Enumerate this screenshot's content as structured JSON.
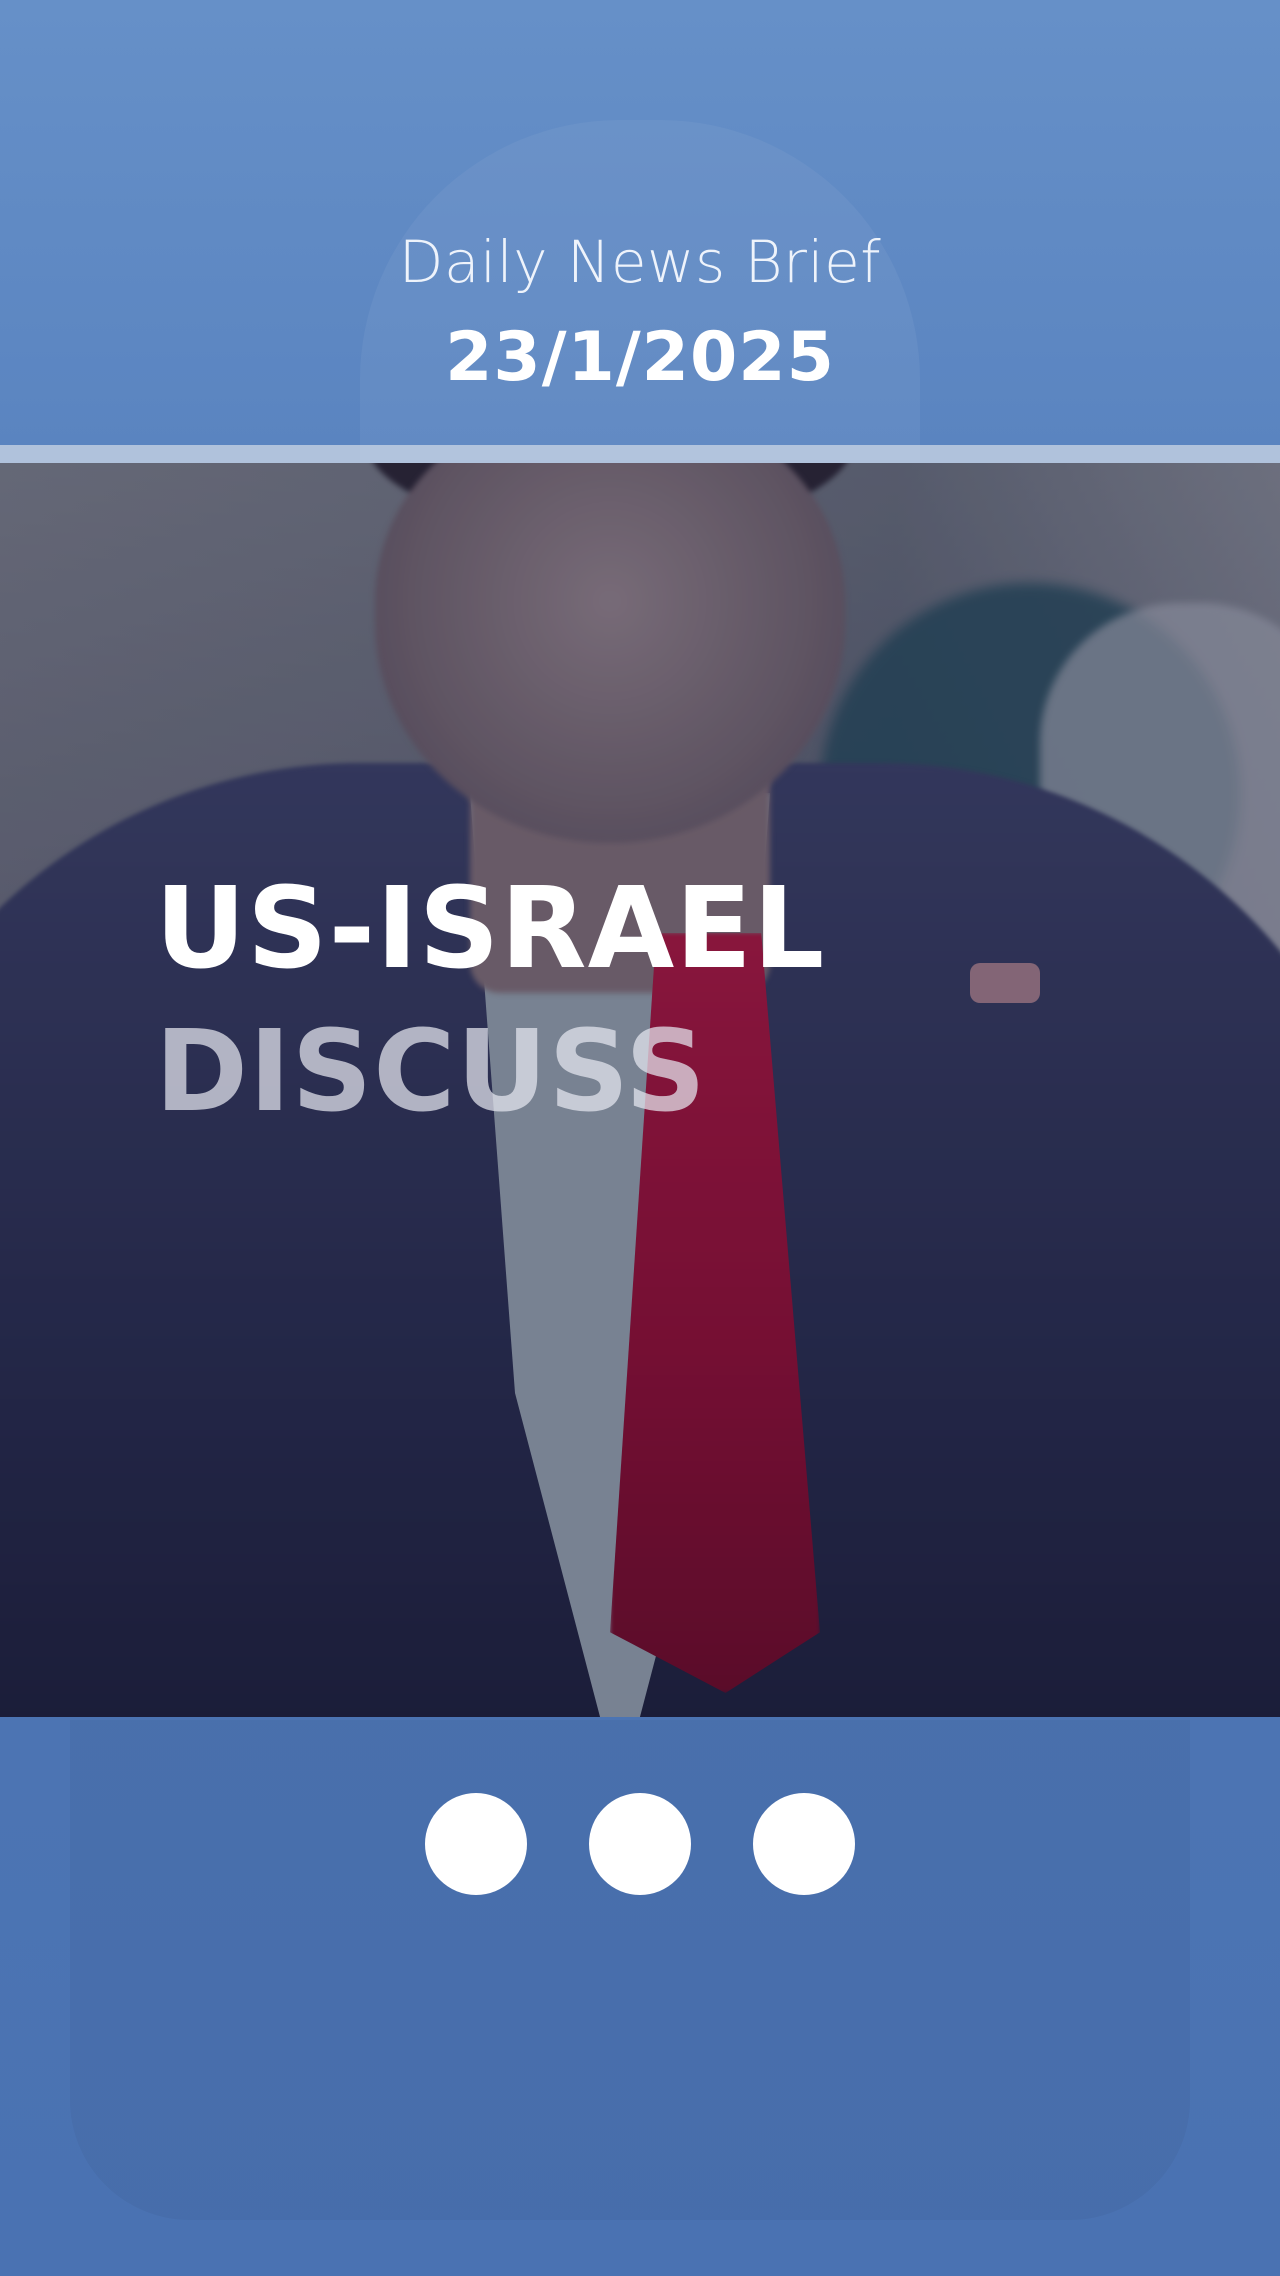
{
  "header": {
    "title": "Daily News Brief",
    "date": "23/1/2025"
  },
  "story": {
    "headline_line1": "US-ISRAEL",
    "headline_line2": "DISCUSS"
  },
  "pager": {
    "dot_count": 3
  },
  "colors": {
    "panel_blue": "#5a84c0",
    "divider": "#cdd7e6",
    "tie_red": "#a2163e"
  }
}
